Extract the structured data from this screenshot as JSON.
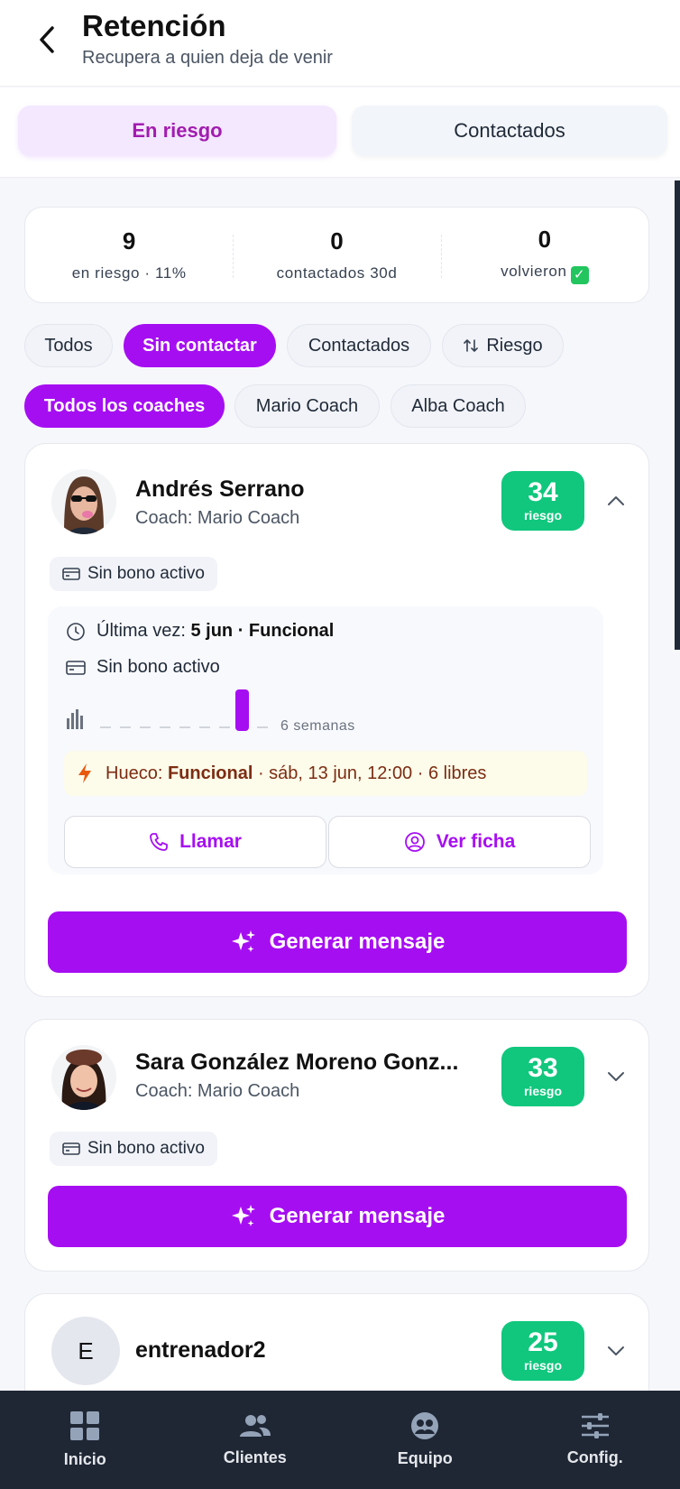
{
  "header": {
    "title": "Retención",
    "subtitle": "Recupera a quien deja de venir"
  },
  "top_tabs": [
    {
      "label": "En riesgo",
      "active": true
    },
    {
      "label": "Contactados",
      "active": false
    }
  ],
  "stats": [
    {
      "value": "9",
      "label": "en riesgo · 11%"
    },
    {
      "value": "0",
      "label": "contactados 30d"
    },
    {
      "value": "0",
      "label": "volvieron"
    }
  ],
  "filters": [
    {
      "label": "Todos",
      "active": false
    },
    {
      "label": "Sin contactar",
      "active": true
    },
    {
      "label": "Contactados",
      "active": false
    },
    {
      "label": "Riesgo",
      "active": false
    }
  ],
  "coach_filters": [
    {
      "label": "Todos los coaches",
      "active": true
    },
    {
      "label": "Mario Coach",
      "active": false
    },
    {
      "label": "Alba Coach",
      "active": false
    }
  ],
  "clients": [
    {
      "name": "Andrés Serrano",
      "coach": "Coach: Mario Coach",
      "risk": "34",
      "risk_label": "riesgo",
      "bono": "Sin bono activo",
      "expanded": true,
      "last_visit_label": "Última vez:",
      "last_visit_value": "5 jun · Funcional",
      "bono_detail": "Sin bono activo",
      "weeks_label": "6 semanas",
      "hueco_label": "Hueco:",
      "hueco_class": "Funcional",
      "hueco_detail": "· sáb, 13 jun, 12:00 · 6 libres",
      "call_label": "Llamar",
      "profile_label": "Ver ficha",
      "generate_label": "Generar mensaje"
    },
    {
      "name": "Sara González Moreno Gonz...",
      "coach": "Coach: Mario Coach",
      "risk": "33",
      "risk_label": "riesgo",
      "bono": "Sin bono activo",
      "expanded": false,
      "generate_label": "Generar mensaje"
    },
    {
      "name": "entrenador2",
      "initial": "E",
      "risk": "25",
      "risk_label": "riesgo",
      "expanded": false
    }
  ],
  "bottom_nav": [
    {
      "label": "Inicio",
      "icon": "grid-icon"
    },
    {
      "label": "Clientes",
      "icon": "users-icon"
    },
    {
      "label": "Equipo",
      "icon": "team-icon"
    },
    {
      "label": "Config.",
      "icon": "sliders-icon"
    }
  ],
  "colors": {
    "accent": "#a60ef2",
    "risk_green": "#10c77d",
    "nav_bg": "#1f2735"
  }
}
